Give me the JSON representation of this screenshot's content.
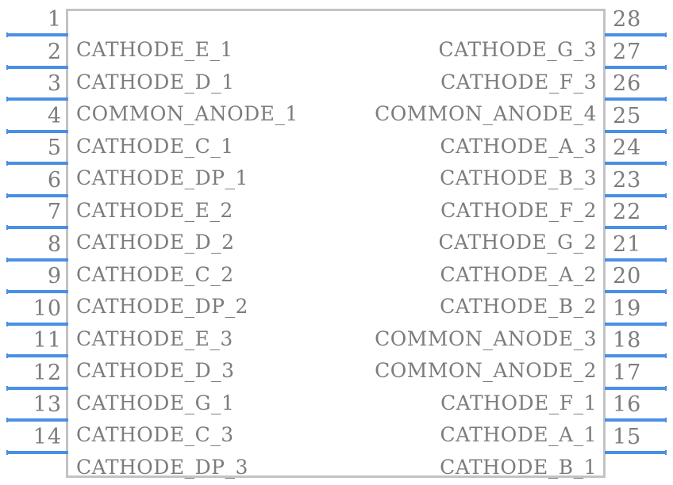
{
  "symbol": {
    "type": "schematic-symbol",
    "pin_count": 28,
    "colors": {
      "pin_line": "#4a8fe3",
      "body_outline": "#c3c3c3",
      "text": "#7c7c7c",
      "background": "#ffffff"
    },
    "left_pins": [
      {
        "number": "1",
        "label": "CATHODE_E_1"
      },
      {
        "number": "2",
        "label": "CATHODE_D_1"
      },
      {
        "number": "3",
        "label": "COMMON_ANODE_1"
      },
      {
        "number": "4",
        "label": "CATHODE_C_1"
      },
      {
        "number": "5",
        "label": "CATHODE_DP_1"
      },
      {
        "number": "6",
        "label": "CATHODE_E_2"
      },
      {
        "number": "7",
        "label": "CATHODE_D_2"
      },
      {
        "number": "8",
        "label": "CATHODE_C_2"
      },
      {
        "number": "9",
        "label": "CATHODE_DP_2"
      },
      {
        "number": "10",
        "label": "CATHODE_E_3"
      },
      {
        "number": "11",
        "label": "CATHODE_D_3"
      },
      {
        "number": "12",
        "label": "CATHODE_G_1"
      },
      {
        "number": "13",
        "label": "CATHODE_C_3"
      },
      {
        "number": "14",
        "label": "CATHODE_DP_3"
      }
    ],
    "right_pins": [
      {
        "number": "28",
        "label": "CATHODE_G_3"
      },
      {
        "number": "27",
        "label": "CATHODE_F_3"
      },
      {
        "number": "26",
        "label": "COMMON_ANODE_4"
      },
      {
        "number": "25",
        "label": "CATHODE_A_3"
      },
      {
        "number": "24",
        "label": "CATHODE_B_3"
      },
      {
        "number": "23",
        "label": "CATHODE_F_2"
      },
      {
        "number": "22",
        "label": "CATHODE_G_2"
      },
      {
        "number": "21",
        "label": "CATHODE_A_2"
      },
      {
        "number": "20",
        "label": "CATHODE_B_2"
      },
      {
        "number": "19",
        "label": "COMMON_ANODE_3"
      },
      {
        "number": "18",
        "label": "COMMON_ANODE_2"
      },
      {
        "number": "17",
        "label": "CATHODE_F_1"
      },
      {
        "number": "16",
        "label": "CATHODE_A_1"
      },
      {
        "number": "15",
        "label": "CATHODE_B_1"
      }
    ]
  }
}
